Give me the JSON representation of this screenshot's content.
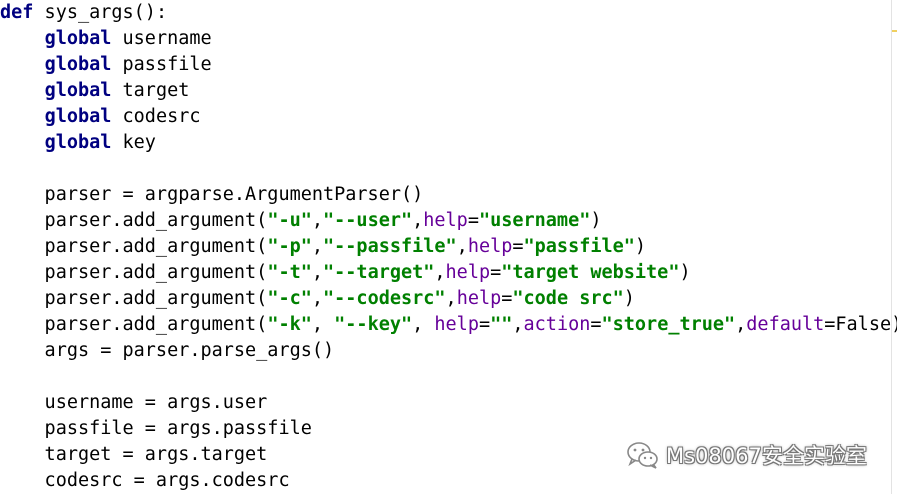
{
  "code": {
    "lines": [
      [
        {
          "t": "def",
          "c": "kw"
        },
        {
          "t": " sys_args():",
          "c": "fn"
        }
      ],
      [
        {
          "t": "    ",
          "c": "plain"
        },
        {
          "t": "global",
          "c": "kw"
        },
        {
          "t": " username",
          "c": "plain"
        }
      ],
      [
        {
          "t": "    ",
          "c": "plain"
        },
        {
          "t": "global",
          "c": "kw"
        },
        {
          "t": " passfile",
          "c": "plain"
        }
      ],
      [
        {
          "t": "    ",
          "c": "plain"
        },
        {
          "t": "global",
          "c": "kw"
        },
        {
          "t": " target",
          "c": "plain"
        }
      ],
      [
        {
          "t": "    ",
          "c": "plain"
        },
        {
          "t": "global",
          "c": "kw"
        },
        {
          "t": " codesrc",
          "c": "plain"
        }
      ],
      [
        {
          "t": "    ",
          "c": "plain"
        },
        {
          "t": "global",
          "c": "kw"
        },
        {
          "t": " key",
          "c": "plain"
        }
      ],
      [],
      [
        {
          "t": "    parser = argparse.ArgumentParser()",
          "c": "plain"
        }
      ],
      [
        {
          "t": "    parser.add_argument(",
          "c": "plain"
        },
        {
          "t": "\"-u\"",
          "c": "str"
        },
        {
          "t": ",",
          "c": "plain"
        },
        {
          "t": "\"--user\"",
          "c": "str"
        },
        {
          "t": ",",
          "c": "plain"
        },
        {
          "t": "help",
          "c": "kwarg"
        },
        {
          "t": "=",
          "c": "plain"
        },
        {
          "t": "\"username\"",
          "c": "str"
        },
        {
          "t": ")",
          "c": "plain"
        }
      ],
      [
        {
          "t": "    parser.add_argument(",
          "c": "plain"
        },
        {
          "t": "\"-p\"",
          "c": "str"
        },
        {
          "t": ",",
          "c": "plain"
        },
        {
          "t": "\"--passfile\"",
          "c": "str"
        },
        {
          "t": ",",
          "c": "plain"
        },
        {
          "t": "help",
          "c": "kwarg"
        },
        {
          "t": "=",
          "c": "plain"
        },
        {
          "t": "\"passfile\"",
          "c": "str"
        },
        {
          "t": ")",
          "c": "plain"
        }
      ],
      [
        {
          "t": "    parser.add_argument(",
          "c": "plain"
        },
        {
          "t": "\"-t\"",
          "c": "str"
        },
        {
          "t": ",",
          "c": "plain"
        },
        {
          "t": "\"--target\"",
          "c": "str"
        },
        {
          "t": ",",
          "c": "plain"
        },
        {
          "t": "help",
          "c": "kwarg"
        },
        {
          "t": "=",
          "c": "plain"
        },
        {
          "t": "\"target website\"",
          "c": "str"
        },
        {
          "t": ")",
          "c": "plain"
        }
      ],
      [
        {
          "t": "    parser.add_argument(",
          "c": "plain"
        },
        {
          "t": "\"-c\"",
          "c": "str"
        },
        {
          "t": ",",
          "c": "plain"
        },
        {
          "t": "\"--codesrc\"",
          "c": "str"
        },
        {
          "t": ",",
          "c": "plain"
        },
        {
          "t": "help",
          "c": "kwarg"
        },
        {
          "t": "=",
          "c": "plain"
        },
        {
          "t": "\"code src\"",
          "c": "str"
        },
        {
          "t": ")",
          "c": "plain"
        }
      ],
      [
        {
          "t": "    parser.add_argument(",
          "c": "plain"
        },
        {
          "t": "\"-k\"",
          "c": "str"
        },
        {
          "t": ", ",
          "c": "plain"
        },
        {
          "t": "\"--key\"",
          "c": "str"
        },
        {
          "t": ", ",
          "c": "plain"
        },
        {
          "t": "help",
          "c": "kwarg"
        },
        {
          "t": "=",
          "c": "plain"
        },
        {
          "t": "\"\"",
          "c": "str"
        },
        {
          "t": ",",
          "c": "plain"
        },
        {
          "t": "action",
          "c": "kwarg"
        },
        {
          "t": "=",
          "c": "plain"
        },
        {
          "t": "\"store_true\"",
          "c": "str"
        },
        {
          "t": ",",
          "c": "plain"
        },
        {
          "t": "default",
          "c": "kwarg"
        },
        {
          "t": "=False)",
          "c": "plain"
        }
      ],
      [
        {
          "t": "    args = parser.parse_args()",
          "c": "plain"
        }
      ],
      [],
      [
        {
          "t": "    username = args.user",
          "c": "plain"
        }
      ],
      [
        {
          "t": "    passfile = args.passfile",
          "c": "plain"
        }
      ],
      [
        {
          "t": "    target = args.target",
          "c": "plain"
        }
      ],
      [
        {
          "t": "    codesrc = args.codesrc",
          "c": "plain"
        }
      ]
    ]
  },
  "watermark": {
    "text": "Ms08067安全实验室",
    "icon": "wechat-icon"
  },
  "colors": {
    "background": "#ffffff",
    "keyword": "#000080",
    "string": "#008000",
    "kwarg": "#660099",
    "plain": "#000000"
  }
}
